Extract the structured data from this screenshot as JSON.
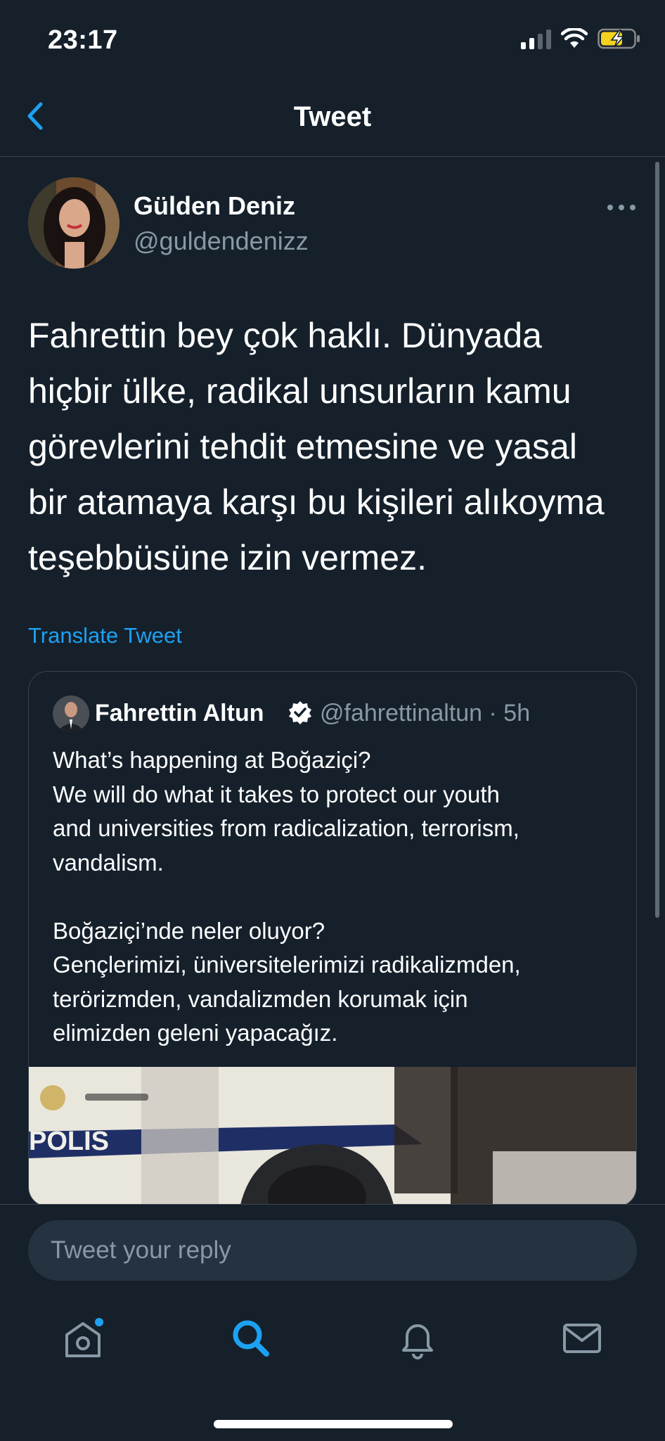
{
  "status_bar": {
    "time": "23:17"
  },
  "header": {
    "title": "Tweet"
  },
  "tweet": {
    "author_name": "Gülden Deniz",
    "author_handle": "@guldendenizz",
    "text": "Fahrettin bey çok haklı. Dünyada\nhiçbir ülke, radikal unsurların kamu\ngörevlerini tehdit etmesine ve yasal\nbir atamaya karşı bu kişileri alıkoyma\nteşebbüsüne izin vermez.",
    "translate_label": "Translate Tweet"
  },
  "quoted_tweet": {
    "author_name": "Fahrettin Altun",
    "author_handle": "@fahrettinaltun · 5h",
    "text": "What’s happening at Boğaziçi?\nWe will do what it takes to protect our youth\nand universities from radicalization, terrorism,\nvandalism.\n\nBoğaziçi’nde neler oluyor?\nGençlerimizi, üniversitelerimizi radikalizmden,\nterörizmden, vandalizmden korumak için\nelimizden geleni yapacağız.",
    "media_text": "POLIS"
  },
  "reply": {
    "placeholder": "Tweet your reply"
  },
  "tabs": [
    "home-icon",
    "search-icon",
    "notifications-icon",
    "messages-icon"
  ],
  "colors": {
    "background": "#15202b",
    "accent": "#1da1f2",
    "secondary_text": "#8899a6",
    "border": "#38444d"
  }
}
